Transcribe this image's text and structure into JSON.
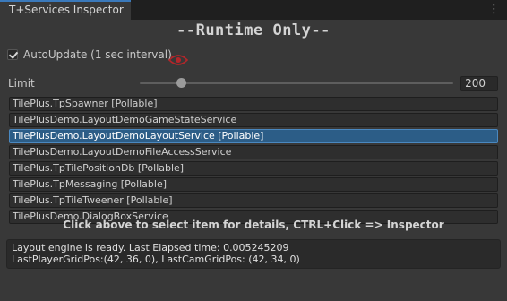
{
  "window": {
    "tab_title": "T+Services Inspector",
    "menu_icon": "kebab-menu-icon"
  },
  "title": "--Runtime Only--",
  "autoupdate": {
    "checked": true,
    "label": "AutoUpdate (1 sec interval)",
    "indicator_icon": "eye-icon",
    "indicator_color": "#b3262a"
  },
  "limit": {
    "label": "Limit",
    "value": "200",
    "slider_fraction": 0.13
  },
  "services": {
    "selected_index": 2,
    "items": [
      "TilePlus.TpSpawner [Pollable]",
      "TilePlusDemo.LayoutDemoGameStateService",
      "TilePlusDemo.LayoutDemoLayoutService [Pollable]",
      "TilePlusDemo.LayoutDemoFileAccessService",
      "TilePlus.TpTilePositionDb [Pollable]",
      "TilePlus.TpMessaging [Pollable]",
      "TilePlus.TpTileTweener [Pollable]",
      "TilePlusDemo.DialogBoxService"
    ]
  },
  "hint": "Click above to select item for details, CTRL+Click => Inspector",
  "details": {
    "line1": "Layout engine is ready. Last Elapsed time: 0.005245209",
    "line2": "LastPlayerGridPos:(42, 36, 0), LastCamGridPos: (42, 34, 0)"
  },
  "colors": {
    "accent": "#3a79bb",
    "selection": "#2c5d87"
  }
}
